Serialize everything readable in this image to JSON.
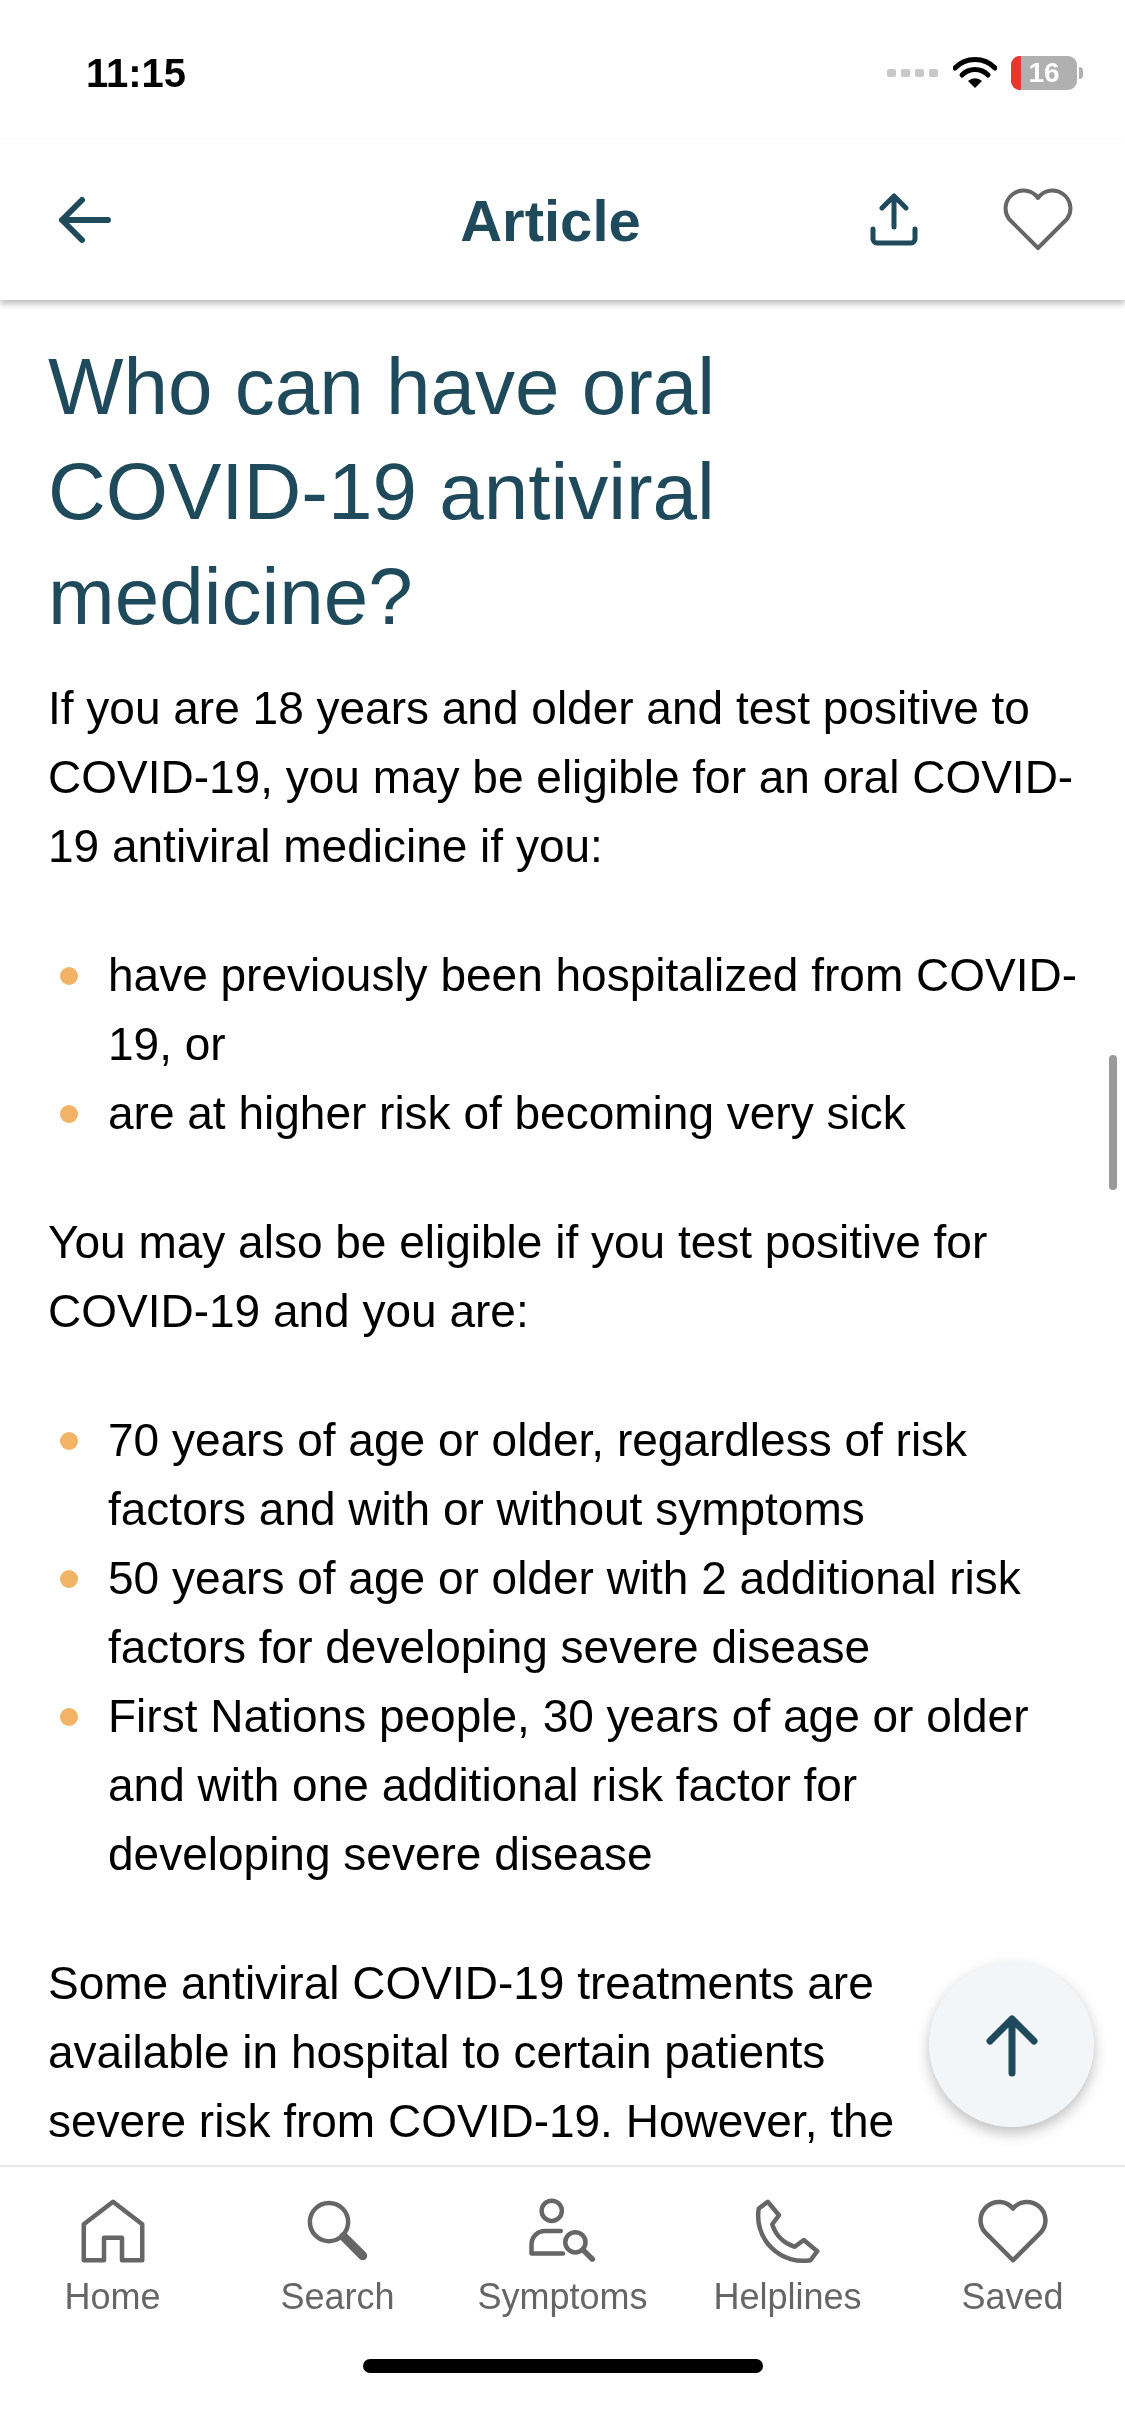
{
  "status_bar": {
    "time": "11:15",
    "battery": "16"
  },
  "header": {
    "title": "Article"
  },
  "article": {
    "heading": "Who can have oral COVID-19 antiviral medicine?",
    "blocks": [
      {
        "kind": "paragraph",
        "text": "If you are 18 years and older and test positive to COVID-19, you may be eligible for an oral COVID-19 antiviral medicine if you:"
      },
      {
        "kind": "list",
        "items": [
          "have previously been hospitalized from COVID-19, or",
          "are at higher risk of becoming very sick"
        ]
      },
      {
        "kind": "paragraph",
        "text": "You may also be eligible if you test positive for COVID-19 and you are:"
      },
      {
        "kind": "list",
        "items": [
          "70 years of age or older, regardless of risk factors and with or without symptoms",
          "50 years of age or older with 2 additional risk factors for developing severe disease",
          "First Nations people, 30 years of age or older and with one additional risk factor for developing severe disease"
        ]
      },
      {
        "kind": "lines",
        "lines": [
          "Some antiviral COVID-19 treatments are",
          "available in hospital to certain patients",
          "severe risk from COVID-19. However, the"
        ]
      }
    ]
  },
  "tab_bar": [
    {
      "kind": "home",
      "label": "Home",
      "selected": false
    },
    {
      "kind": "search",
      "label": "Search",
      "selected": false
    },
    {
      "kind": "symptoms",
      "label": "Symptoms",
      "selected": false
    },
    {
      "kind": "helplines",
      "label": "Helplines",
      "selected": false
    },
    {
      "kind": "saved",
      "label": "Saved",
      "selected": false
    }
  ]
}
